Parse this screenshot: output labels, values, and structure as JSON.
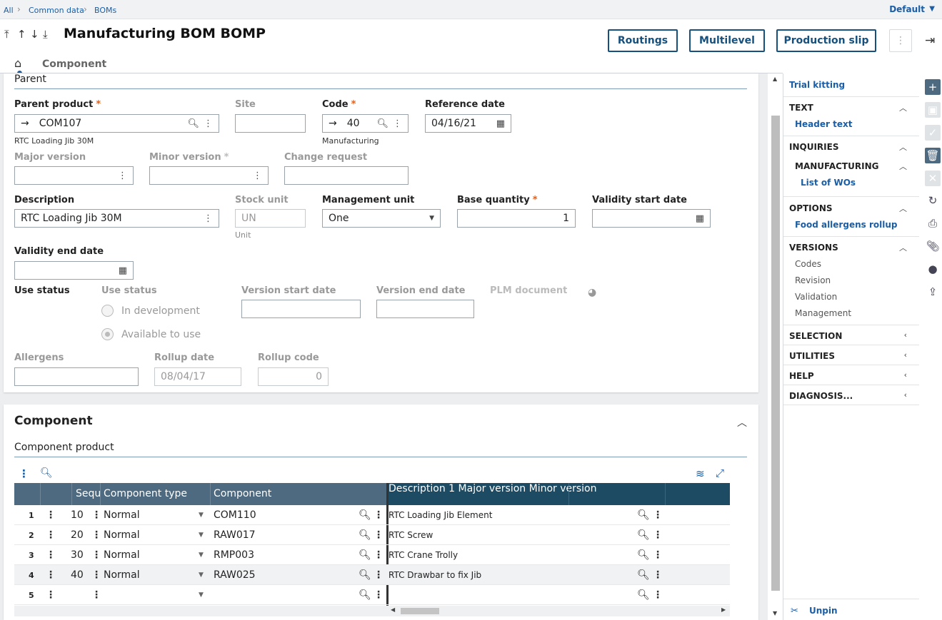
{
  "breadcrumb": {
    "all": "All",
    "common": "Common data",
    "boms": "BOMs",
    "default": "Default"
  },
  "title": "Manufacturing BOM BOMP",
  "buttons": {
    "routings": "Routings",
    "multilevel": "Multilevel",
    "production_slip": "Production slip"
  },
  "tabs": {
    "component": "Component"
  },
  "parent": {
    "section": "Parent",
    "parent_product_label": "Parent product",
    "parent_product_value": "COM107",
    "parent_product_desc": "RTC Loading Jib 30M",
    "site_label": "Site",
    "site_value": "",
    "code_label": "Code",
    "code_value": "40",
    "code_desc": "Manufacturing",
    "reference_date_label": "Reference date",
    "reference_date_value": "04/16/21",
    "major_version_label": "Major version",
    "minor_version_label": "Minor version",
    "change_request_label": "Change request",
    "description_label": "Description",
    "description_value": "RTC Loading Jib 30M",
    "stock_unit_label": "Stock unit",
    "stock_unit_value": "UN",
    "stock_unit_desc": "Unit",
    "management_unit_label": "Management unit",
    "management_unit_value": "One",
    "base_quantity_label": "Base quantity",
    "base_quantity_value": "1",
    "validity_start_label": "Validity start date",
    "validity_end_label": "Validity end date",
    "use_status_label": "Use status",
    "use_status_sub": "Use status",
    "opt_dev": "In development",
    "opt_avail": "Available to use",
    "version_start_label": "Version start date",
    "version_end_label": "Version end date",
    "plm_label": "PLM document",
    "allergens_label": "Allergens",
    "rollup_date_label": "Rollup date",
    "rollup_date_value": "08/04/17",
    "rollup_code_label": "Rollup code",
    "rollup_code_value": "0"
  },
  "component": {
    "title": "Component",
    "sub": "Component product",
    "columns": [
      "Sequ...",
      "Component type",
      "Component",
      "Description 1",
      "Major version",
      "Minor version"
    ],
    "rows": [
      {
        "n": "1",
        "seq": "10",
        "type": "Normal",
        "comp": "COM110",
        "desc": "RTC Loading Jib Element"
      },
      {
        "n": "2",
        "seq": "20",
        "type": "Normal",
        "comp": "RAW017",
        "desc": "RTC Screw"
      },
      {
        "n": "3",
        "seq": "30",
        "type": "Normal",
        "comp": "RMP003",
        "desc": "RTC Crane Trolly"
      },
      {
        "n": "4",
        "seq": "40",
        "type": "Normal",
        "comp": "RAW025",
        "desc": "RTC Drawbar to fix Jib"
      },
      {
        "n": "5",
        "seq": "",
        "type": "",
        "comp": "",
        "desc": ""
      }
    ]
  },
  "sidebar": {
    "trial_kitting": "Trial kitting",
    "text": "TEXT",
    "header_text": "Header text",
    "inquiries": "INQUIRIES",
    "manufacturing": "MANUFACTURING",
    "list_wos": "List of WOs",
    "options": "OPTIONS",
    "food_allergens": "Food allergens rollup",
    "versions": "VERSIONS",
    "codes": "Codes",
    "revision": "Revision",
    "validation": "Validation",
    "management": "Management",
    "selection": "SELECTION",
    "utilities": "UTILITIES",
    "help": "HELP",
    "diagnosis": "DIAGNOSIS...",
    "unpin": "Unpin"
  },
  "colors": {
    "accent": "#1b5ea6",
    "header": "#4d6a80",
    "header_dark": "#1d4b63",
    "required": "#e0601a"
  }
}
